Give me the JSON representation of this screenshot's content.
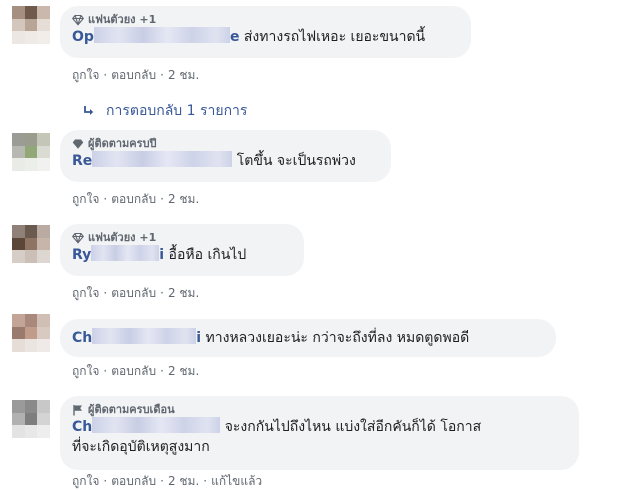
{
  "comments": [
    {
      "badge": "แฟนตัวยง +1",
      "badge_icon": "diamond-icon",
      "author_visible_start": "Op",
      "author_visible_end": "e",
      "text": "ส่งทางรถไฟเหอะ เยอะขนาดนี้",
      "like": "ถูกใจ",
      "reply": "ตอบกลับ",
      "time": "2 ชม."
    },
    {
      "badge": "ผู้ติดตามครบปี",
      "badge_icon": "gem-icon",
      "author_visible_start": "Re",
      "author_visible_end": "",
      "text": "โตขึ้น จะเป็นรถพ่วง",
      "like": "ถูกใจ",
      "reply": "ตอบกลับ",
      "time": "2 ชม."
    },
    {
      "badge": "แฟนตัวยง +1",
      "badge_icon": "diamond-icon",
      "author_visible_start": "Ry",
      "author_visible_end": "i",
      "text": "อื้อหือ เกินไป",
      "like": "ถูกใจ",
      "reply": "ตอบกลับ",
      "time": "2 ชม."
    },
    {
      "badge": "",
      "badge_icon": "",
      "author_visible_start": "Ch",
      "author_visible_end": "i",
      "text": "ทางหลวงเยอะน่ะ กว่าจะถึงที่ลง หมดตูดพอดี",
      "like": "ถูกใจ",
      "reply": "ตอบกลับ",
      "time": "2 ชม."
    },
    {
      "badge": "ผู้ติดตามครบเดือน",
      "badge_icon": "flag-icon",
      "author_visible_start": "Ch",
      "author_visible_end": "",
      "text": "จะงกกันไปถึงไหน แบ่งใส่อีกคันก็ได้ โอกาส",
      "text2": "ที่จะเกิดอุบัติเหตุสูงมาก",
      "like": "ถูกใจ",
      "reply": "ตอบกลับ",
      "time": "2 ชม.",
      "edited": "แก้ไขแล้ว"
    }
  ],
  "replies_link": "การตอบกลับ 1 รายการ",
  "dot": "·",
  "colors": {
    "bubble": "#f2f3f5",
    "author": "#385898",
    "meta": "#606770",
    "text": "#1c1e21"
  }
}
